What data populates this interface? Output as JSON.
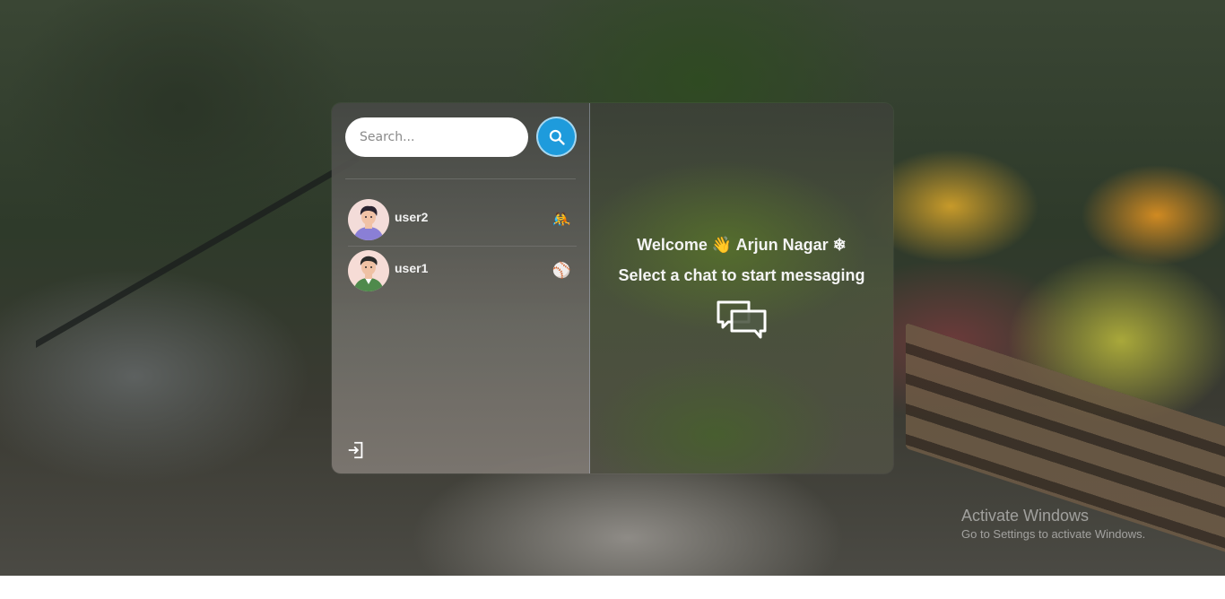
{
  "search": {
    "placeholder": "Search..."
  },
  "conversations": [
    {
      "name": "user2",
      "emoji": "🤼"
    },
    {
      "name": "user1",
      "emoji": "⚾"
    }
  ],
  "welcome": {
    "greeting": "Welcome 👋 Arjun Nagar ❄",
    "subtitle": "Select a chat to start messaging"
  },
  "watermark": {
    "title": "Activate Windows",
    "subtitle": "Go to Settings to activate Windows."
  },
  "colors": {
    "accent": "#1e9bdc",
    "text": "#f4f4f4"
  },
  "icons": {
    "search_button": "search-icon",
    "logout": "logout-icon",
    "empty_chat": "chat-bubbles-icon"
  }
}
